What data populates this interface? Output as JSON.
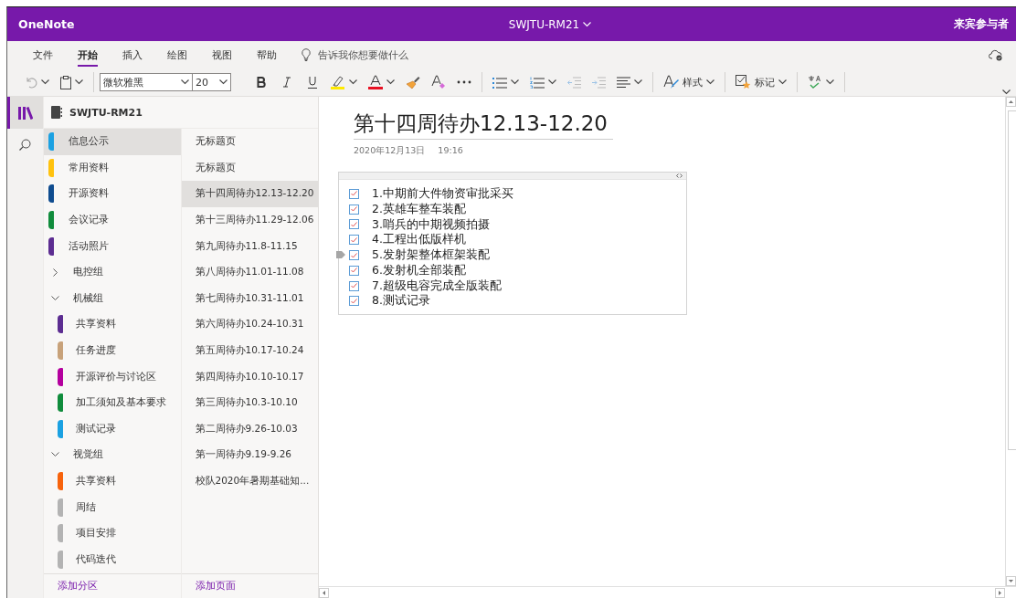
{
  "app": {
    "name": "OneNote",
    "notebook": "SWJTU-RM21",
    "user": "来宾参与者"
  },
  "ribbon_tabs": [
    {
      "label": "文件",
      "selected": false
    },
    {
      "label": "开始",
      "selected": true
    },
    {
      "label": "插入",
      "selected": false
    },
    {
      "label": "绘图",
      "selected": false
    },
    {
      "label": "视图",
      "selected": false
    },
    {
      "label": "帮助",
      "selected": false
    }
  ],
  "tell_me": {
    "placeholder": "告诉我你想要做什么"
  },
  "toolbar": {
    "font": "微软雅黑",
    "size": "20",
    "styles": "样式",
    "tags": "标记"
  },
  "notebook": {
    "name": "SWJTU-RM21"
  },
  "sections": [
    {
      "kind": "section",
      "label": "信息公示",
      "color": "#1ba1e2",
      "selected": true
    },
    {
      "kind": "section",
      "label": "常用资料",
      "color": "#ffc20e",
      "selected": false
    },
    {
      "kind": "section",
      "label": "开源资料",
      "color": "#0f4c8f",
      "selected": false
    },
    {
      "kind": "section",
      "label": "会议记录",
      "color": "#108c3c",
      "selected": false
    },
    {
      "kind": "section",
      "label": "活动照片",
      "color": "#5c2d91",
      "selected": false
    },
    {
      "kind": "group",
      "label": "电控组",
      "expanded": false
    },
    {
      "kind": "group",
      "label": "机械组",
      "expanded": true,
      "children": [
        {
          "kind": "section",
          "label": "共享资料",
          "color": "#5c2d91",
          "selected": false
        },
        {
          "kind": "section",
          "label": "任务进度",
          "color": "#c8a27a",
          "selected": false
        },
        {
          "kind": "section",
          "label": "开源评价与讨论区",
          "color": "#b4009e",
          "selected": false
        },
        {
          "kind": "section",
          "label": "加工须知及基本要求",
          "color": "#108c3c",
          "selected": false
        },
        {
          "kind": "section",
          "label": "测试记录",
          "color": "#1ba1e2",
          "selected": false
        }
      ]
    },
    {
      "kind": "group",
      "label": "视觉组",
      "expanded": true,
      "children": [
        {
          "kind": "section",
          "label": "共享资料",
          "color": "#f7630c",
          "selected": false
        },
        {
          "kind": "section",
          "label": "周结",
          "color": "#b3b3b3",
          "selected": false
        },
        {
          "kind": "section",
          "label": "项目安排",
          "color": "#b3b3b3",
          "selected": false
        },
        {
          "kind": "section",
          "label": "代码迭代",
          "color": "#b3b3b3",
          "selected": false
        }
      ]
    }
  ],
  "pages": [
    {
      "title": "无标题页",
      "selected": false
    },
    {
      "title": "无标题页",
      "selected": false
    },
    {
      "title": "第十四周待办12.13-12.20",
      "selected": true
    },
    {
      "title": "第十三周待办11.29-12.06",
      "selected": false
    },
    {
      "title": "第九周待办11.8-11.15",
      "selected": false
    },
    {
      "title": "第八周待办11.01-11.08",
      "selected": false
    },
    {
      "title": "第七周待办10.31-11.01",
      "selected": false
    },
    {
      "title": "第六周待办10.24-10.31",
      "selected": false
    },
    {
      "title": "第五周待办10.17-10.24",
      "selected": false
    },
    {
      "title": "第四周待办10.10-10.17",
      "selected": false
    },
    {
      "title": "第三周待办10.3-10.10",
      "selected": false
    },
    {
      "title": "第二周待办9.26-10.03",
      "selected": false
    },
    {
      "title": "第一周待办9.19-9.26",
      "selected": false
    },
    {
      "title": "校队2020年暑期基础知...",
      "selected": false
    }
  ],
  "add_section": "添加分区",
  "add_page": "添加页面",
  "note": {
    "title": "第十四周待办12.13-12.20",
    "date": "2020年12月13日",
    "time": "19:16",
    "todos": [
      {
        "text": "1.中期前大件物资审批采买",
        "checked": true,
        "focused": false
      },
      {
        "text": "2.英雄车整车装配",
        "checked": true,
        "focused": false
      },
      {
        "text": "3.哨兵的中期视频拍摄",
        "checked": true,
        "focused": false
      },
      {
        "text": "4.工程出低版样机",
        "checked": true,
        "focused": false
      },
      {
        "text": "5.发射架整体框架装配",
        "checked": true,
        "focused": true
      },
      {
        "text": "6.发射机全部装配",
        "checked": true,
        "focused": false
      },
      {
        "text": "7.超级电容完成全版装配",
        "checked": true,
        "focused": false
      },
      {
        "text": "8.测试记录",
        "checked": true,
        "focused": false
      }
    ]
  }
}
